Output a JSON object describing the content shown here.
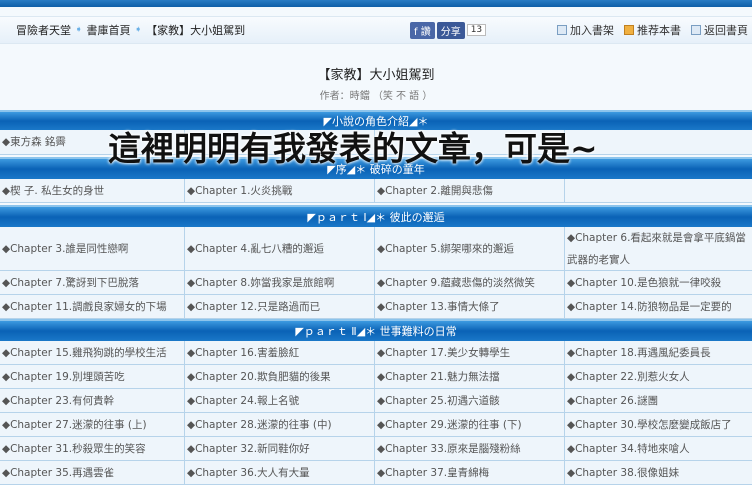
{
  "breadcrumb": [
    "冒險者天堂",
    "書庫首頁",
    "【家教】大小姐駕到"
  ],
  "share": {
    "fb": "f 讚",
    "share": "分享",
    "count": "13"
  },
  "tools": [
    "加入書架",
    "推荐本書",
    "返回書頁"
  ],
  "book": {
    "title": "【家教】大小姐駕到",
    "author": "作者：時鐺 （笑 不 語 ）"
  },
  "overlay": "這裡明明有我發表的文章，可是~",
  "sections": [
    {
      "title": "◤小說の角色介紹◢＊",
      "rows": [
        [
          "◆東方森 銘霽",
          "",
          "",
          ""
        ]
      ]
    },
    {
      "title": "◤序◢＊ 破碎の童年",
      "rows": [
        [
          "◆楔 子. 私生女的身世",
          "◆Chapter 1.火炎挑戰",
          "◆Chapter 2.離開與悲傷",
          ""
        ]
      ]
    },
    {
      "title": "◤ｐａｒｔ Ⅰ◢＊ 彼此の邂逅",
      "rows": [
        [
          "◆Chapter 3.誰是同性戀啊",
          "◆Chapter 4.亂七八糟的邂逅",
          "◆Chapter 5.綁架哪來的邂逅",
          "◆Chapter 6.看起來就是會拿平底鍋當武器的老實人"
        ],
        [
          "◆Chapter 7.驚訝到下巴脫落",
          "◆Chapter 8.妳當我家是旅館啊",
          "◆Chapter 9.蘊藏悲傷的淡然微笑",
          "◆Chapter 10.是色狼就一律咬殺"
        ],
        [
          "◆Chapter 11.調戲良家婦女的下場",
          "◆Chapter 12.只是路過而已",
          "◆Chapter 13.事情大條了",
          "◆Chapter 14.防狼物品是一定要的"
        ]
      ]
    },
    {
      "title": "◤ｐａｒｔ Ⅱ◢＊ 世事難料の日常",
      "rows": [
        [
          "◆Chapter 15.雞飛狗跳的學校生活",
          "◆Chapter 16.害羞臉紅",
          "◆Chapter 17.美少女轉學生",
          "◆Chapter 18.再遇風紀委員長"
        ],
        [
          "◆Chapter 19.別埋頭苦吃",
          "◆Chapter 20.欺負肥貓的後果",
          "◆Chapter 21.魅力無法擋",
          "◆Chapter 22.別惹火女人"
        ],
        [
          "◆Chapter 23.有何貴幹",
          "◆Chapter 24.報上名號",
          "◆Chapter 25.初遇六道骸",
          "◆Chapter 26.謎團"
        ],
        [
          "◆Chapter 27.迷濛的往事 (上)",
          "◆Chapter 28.迷濛的往事 (中)",
          "◆Chapter 29.迷濛的往事 (下)",
          "◆Chapter 30.學校怎麼變成飯店了"
        ],
        [
          "◆Chapter 31.秒殺眾生的笑容",
          "◆Chapter 32.新同鞋你好",
          "◆Chapter 33.原來是腦殘粉絲",
          "◆Chapter 34.特地來嗆人"
        ],
        [
          "◆Chapter 35.再遇雲雀",
          "◆Chapter 36.大人有大量",
          "◆Chapter 37.皇青綿梅",
          "◆Chapter 38.很像姐妹"
        ]
      ]
    }
  ]
}
